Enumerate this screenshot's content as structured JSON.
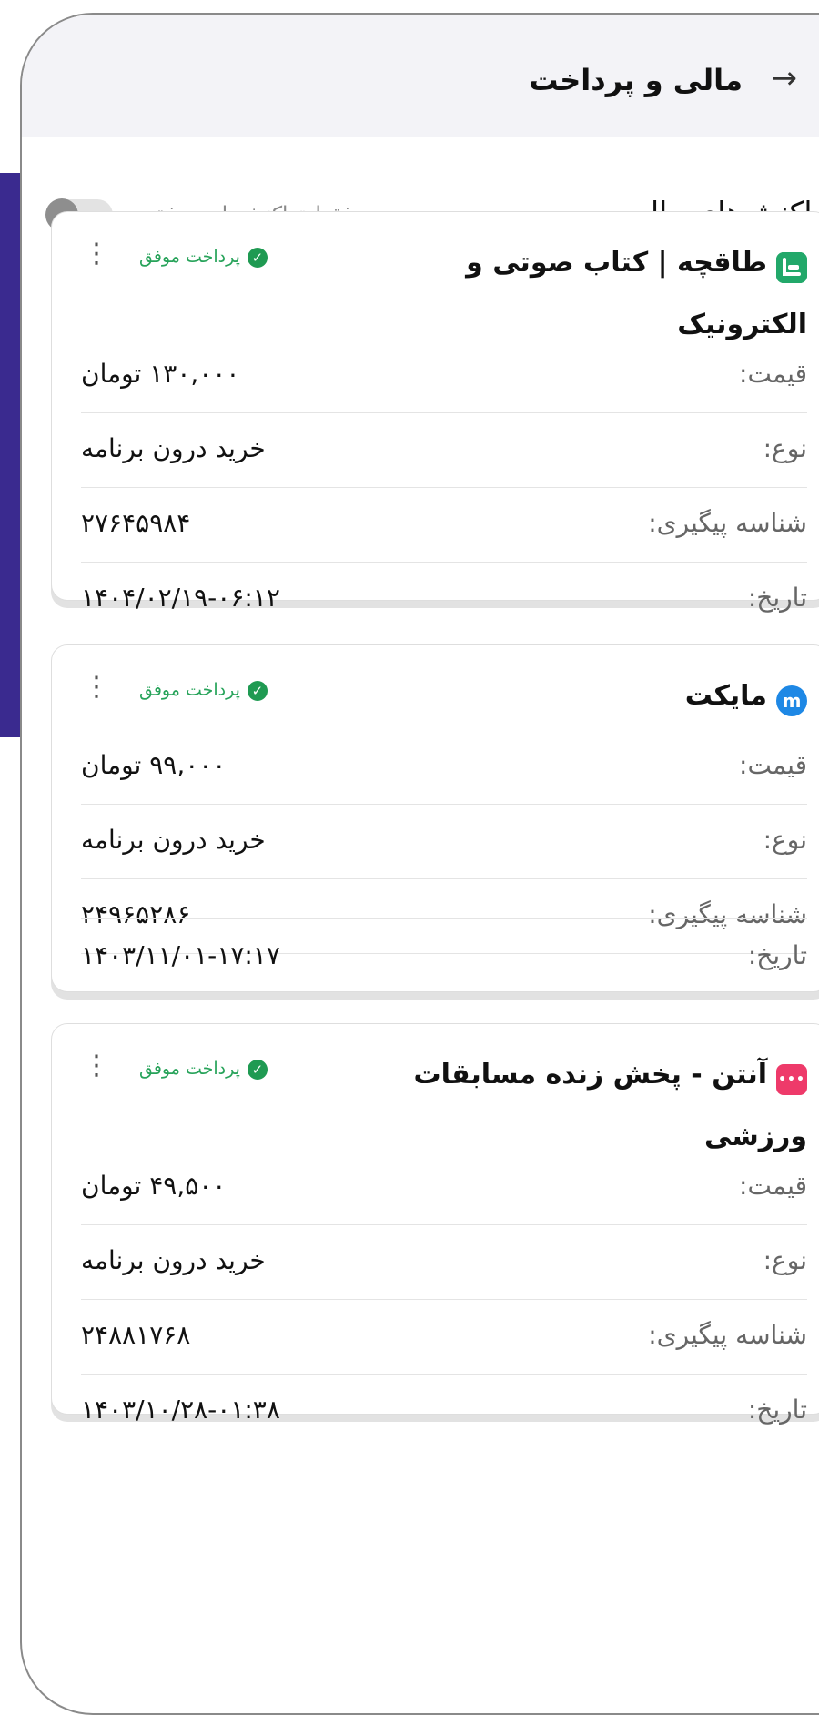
{
  "header": {
    "title": "مالی و پرداخت",
    "back_icon": "→"
  },
  "section": {
    "title": "تراکنش‌های مالی",
    "filter_label": "فقط تراکنش‌های موفق",
    "filter_on": false
  },
  "labels": {
    "price": "قیمت:",
    "type": "نوع:",
    "tracking": "شناسه پیگیری:",
    "date": "تاریخ:"
  },
  "transactions": [
    {
      "app_name": "طاقچه | کتاب صوتی و الکترونیک",
      "icon": "taaghche-icon",
      "icon_color": "#22a86a",
      "status": "پرداخت موفق",
      "price": "۱۳۰,۰۰۰ تومان",
      "type": "خرید درون برنامه",
      "tracking_id": "۲۷۶۴۵۹۸۴",
      "date": "۱۴۰۴/۰۲/۱۹-۰۶:۱۲"
    },
    {
      "app_name": "مایکت",
      "icon": "myket-icon",
      "icon_color": "#1e88e5",
      "status": "پرداخت موفق",
      "price": "۹۹,۰۰۰ تومان",
      "type": "خرید درون برنامه",
      "tracking_id": "۲۴۹۶۵۲۸۶",
      "date": "۱۴۰۳/۱۱/۰۱-۱۷:۱۷"
    },
    {
      "app_name": "آنتن - پخش زنده مسابقات ورزشی",
      "icon": "anten-icon",
      "icon_color": "#ee3a6a",
      "status": "پرداخت موفق",
      "price": "۴۹,۵۰۰ تومان",
      "type": "خرید درون برنامه",
      "tracking_id": "۲۴۸۸۱۷۶۸",
      "date": "۱۴۰۳/۱۰/۲۸-۰۱:۳۸"
    }
  ],
  "colors": {
    "success": "#27a35a",
    "accent_band": "#3a2a8f"
  }
}
